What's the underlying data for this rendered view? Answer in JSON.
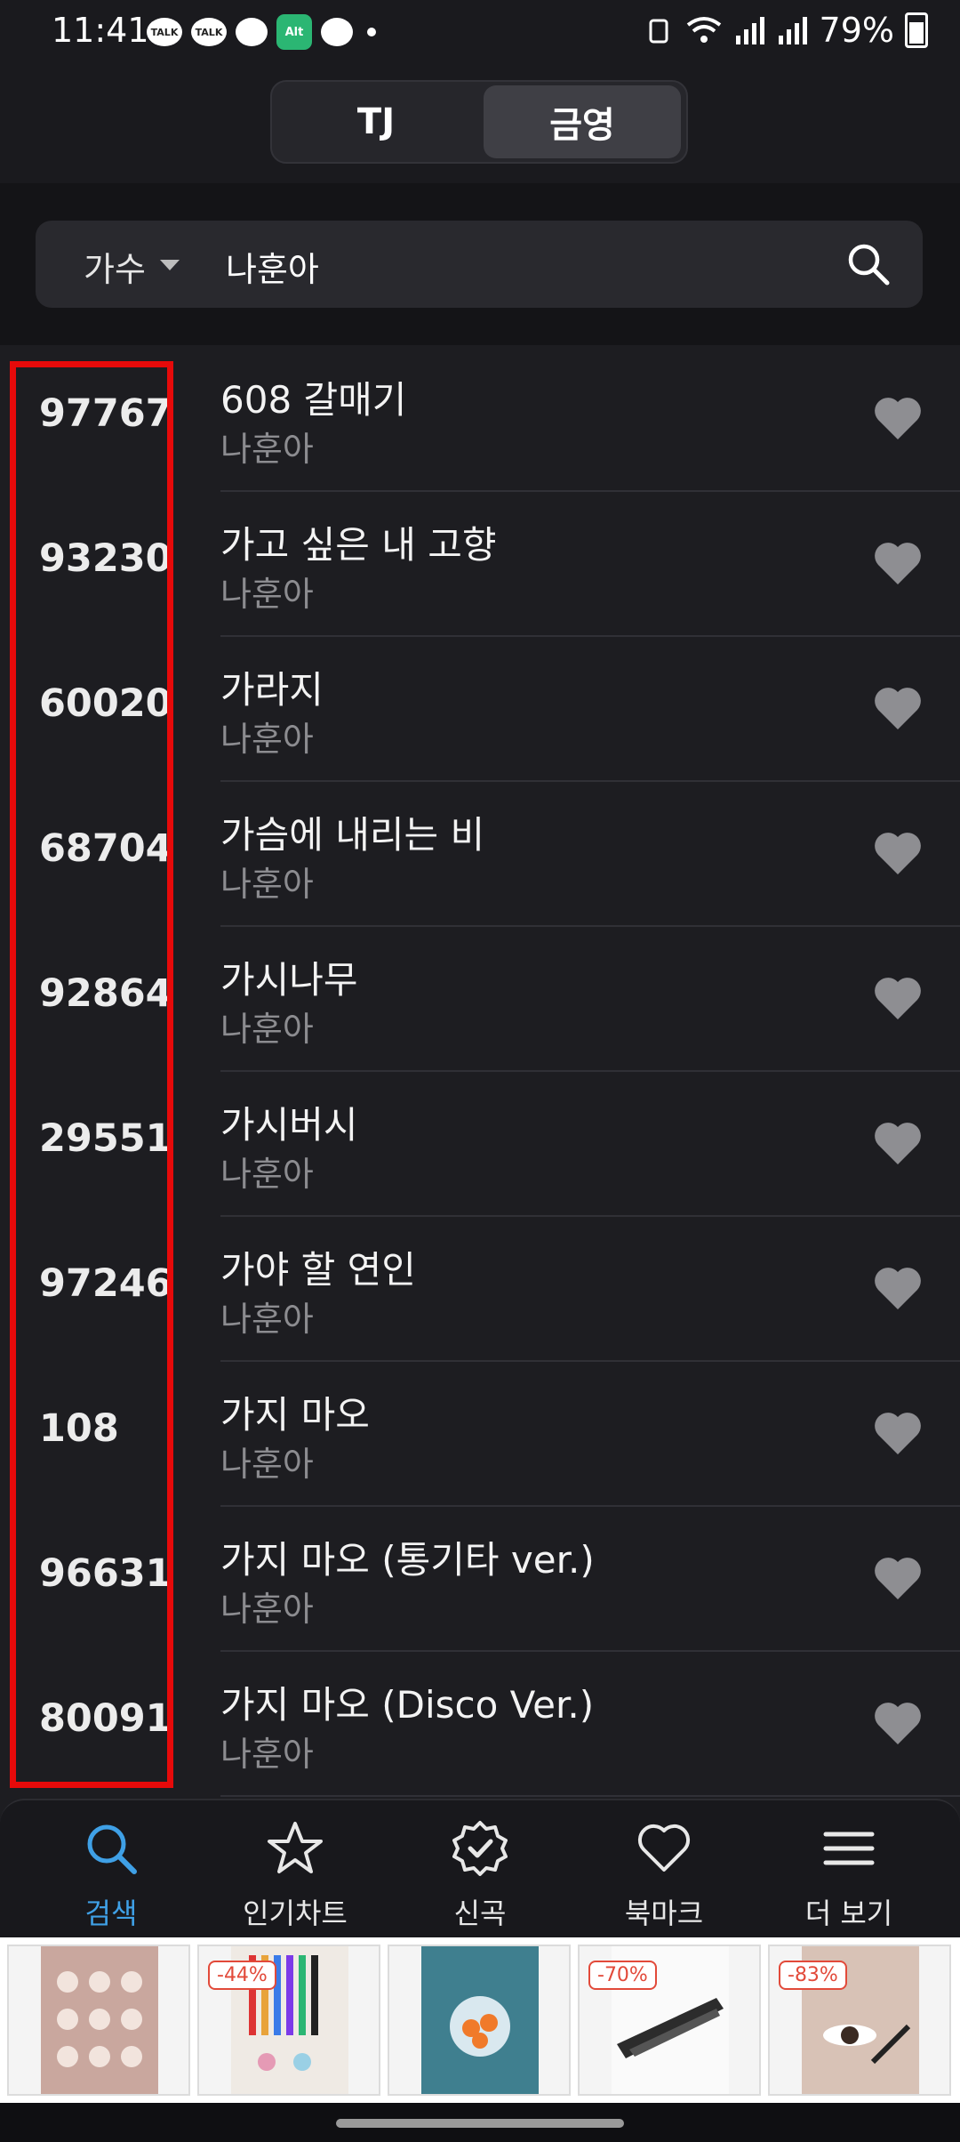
{
  "status_bar": {
    "time": "11:41",
    "battery": "79%",
    "notifications": [
      "TALK",
      "TALK",
      "",
      "Alt",
      ""
    ]
  },
  "tabs": {
    "tj": "TJ",
    "ky": "금영",
    "active": "금영"
  },
  "search": {
    "filter_label": "가수",
    "query": "나훈아"
  },
  "songs": [
    {
      "number": "97767",
      "title": "608 갈매기",
      "artist": "나훈아"
    },
    {
      "number": "93230",
      "title": "가고 싶은 내 고향",
      "artist": "나훈아"
    },
    {
      "number": "60020",
      "title": "가라지",
      "artist": "나훈아"
    },
    {
      "number": "68704",
      "title": "가슴에 내리는 비",
      "artist": "나훈아"
    },
    {
      "number": "92864",
      "title": "가시나무",
      "artist": "나훈아"
    },
    {
      "number": "29551",
      "title": "가시버시",
      "artist": "나훈아"
    },
    {
      "number": "97246",
      "title": "가야 할 연인",
      "artist": "나훈아"
    },
    {
      "number": "108",
      "title": "가지 마오",
      "artist": "나훈아"
    },
    {
      "number": "96631",
      "title": "가지 마오 (통기타 ver.)",
      "artist": "나훈아"
    },
    {
      "number": "80091",
      "title": "가지 마오 (Disco Ver.)",
      "artist": "나훈아"
    }
  ],
  "nav": [
    {
      "label": "검색",
      "icon": "search-icon",
      "active": true
    },
    {
      "label": "인기차트",
      "icon": "star-icon",
      "active": false
    },
    {
      "label": "신곡",
      "icon": "new-badge-icon",
      "active": false
    },
    {
      "label": "북마크",
      "icon": "heart-icon",
      "active": false
    },
    {
      "label": "더 보기",
      "icon": "menu-icon",
      "active": false
    }
  ],
  "ads": [
    {
      "discount": ""
    },
    {
      "discount": "-44%"
    },
    {
      "discount": ""
    },
    {
      "discount": "-70%"
    },
    {
      "discount": "-83%"
    }
  ],
  "colors": {
    "accent": "#3fa0e6",
    "highlight": "#e60a0a",
    "background": "#1d1d21",
    "heart": "#8e8e92"
  }
}
